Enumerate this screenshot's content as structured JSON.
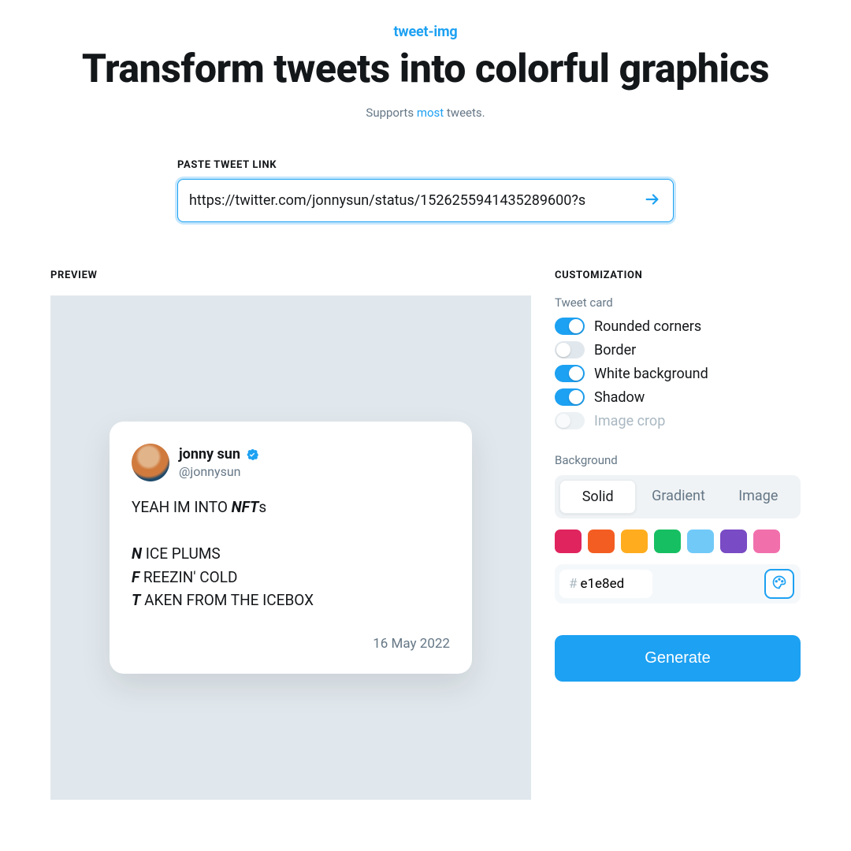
{
  "header": {
    "brand": "tweet-img",
    "title": "Transform tweets into colorful graphics",
    "subtitle_before": "Supports ",
    "subtitle_link": "most",
    "subtitle_after": " tweets."
  },
  "input": {
    "label": "PASTE TWEET LINK",
    "value": "https://twitter.com/jonnysun/status/1526255941435289600?s"
  },
  "columns": {
    "preview": "PREVIEW",
    "customization": "CUSTOMIZATION"
  },
  "tweet": {
    "name": "jonny sun",
    "handle": "@jonnysun",
    "body_line1_plain_before": "YEAH IM INTO ",
    "body_line1_ital": "NFT",
    "body_line1_plain_after": "s",
    "line2_ital": "N",
    "line2_rest": " ICE PLUMS",
    "line3_ital": "F",
    "line3_rest": " REEZIN' COLD",
    "line4_ital": "T",
    "line4_rest": " AKEN FROM THE ICEBOX",
    "date": "16 May 2022"
  },
  "customization": {
    "tweet_card_label": "Tweet card",
    "toggles": [
      {
        "key": "rounded",
        "label": "Rounded corners",
        "on": true,
        "disabled": false
      },
      {
        "key": "border",
        "label": "Border",
        "on": false,
        "disabled": false
      },
      {
        "key": "whitebg",
        "label": "White background",
        "on": true,
        "disabled": false
      },
      {
        "key": "shadow",
        "label": "Shadow",
        "on": true,
        "disabled": false
      },
      {
        "key": "crop",
        "label": "Image crop",
        "on": false,
        "disabled": true
      }
    ],
    "background_label": "Background",
    "bg_tabs": [
      "Solid",
      "Gradient",
      "Image"
    ],
    "bg_tab_active": "Solid",
    "swatches": [
      "#e0245e",
      "#f45d22",
      "#ffad1f",
      "#17bf63",
      "#71c9f8",
      "#794bc4",
      "#f170ac"
    ],
    "hex": "e1e8ed",
    "generate": "Generate"
  },
  "colors": {
    "accent": "#1da1f2",
    "canvas": "#e1e8ed"
  }
}
